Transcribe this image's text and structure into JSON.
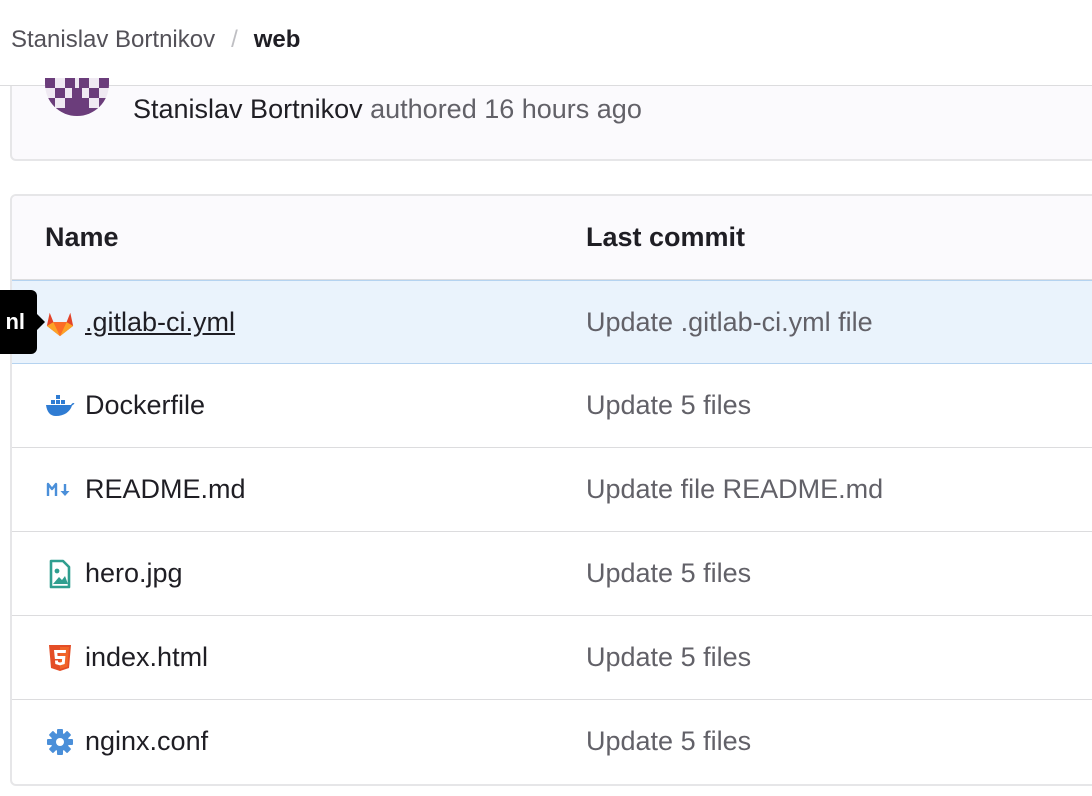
{
  "breadcrumb": {
    "owner": "Stanislav Bortnikov",
    "separator": "/",
    "project": "web"
  },
  "commit": {
    "author": "Stanislav Bortnikov",
    "meta": "authored 16 hours ago"
  },
  "table": {
    "headers": {
      "name": "Name",
      "last_commit": "Last commit"
    },
    "rows": [
      {
        "name": ".gitlab-ci.yml",
        "commit": "Update .gitlab-ci.yml file",
        "icon": "gitlab-icon",
        "hovered": true
      },
      {
        "name": "Dockerfile",
        "commit": "Update 5 files",
        "icon": "docker-icon"
      },
      {
        "name": "README.md",
        "commit": "Update file README.md",
        "icon": "markdown-icon"
      },
      {
        "name": "hero.jpg",
        "commit": "Update 5 files",
        "icon": "image-file-icon"
      },
      {
        "name": "index.html",
        "commit": "Update 5 files",
        "icon": "html5-icon"
      },
      {
        "name": "nginx.conf",
        "commit": "Update 5 files",
        "icon": "gear-icon"
      }
    ]
  },
  "tooltip": {
    "text": "nl"
  },
  "colors": {
    "gitlab": "#e24329",
    "docker": "#2f7cd3",
    "markdown": "#4a8fd9",
    "image": "#2f9e8f",
    "html5": "#e44d26",
    "gear": "#4a8fd9",
    "hover_row": "#eaf3fc",
    "avatar": "#6b3d7b"
  }
}
